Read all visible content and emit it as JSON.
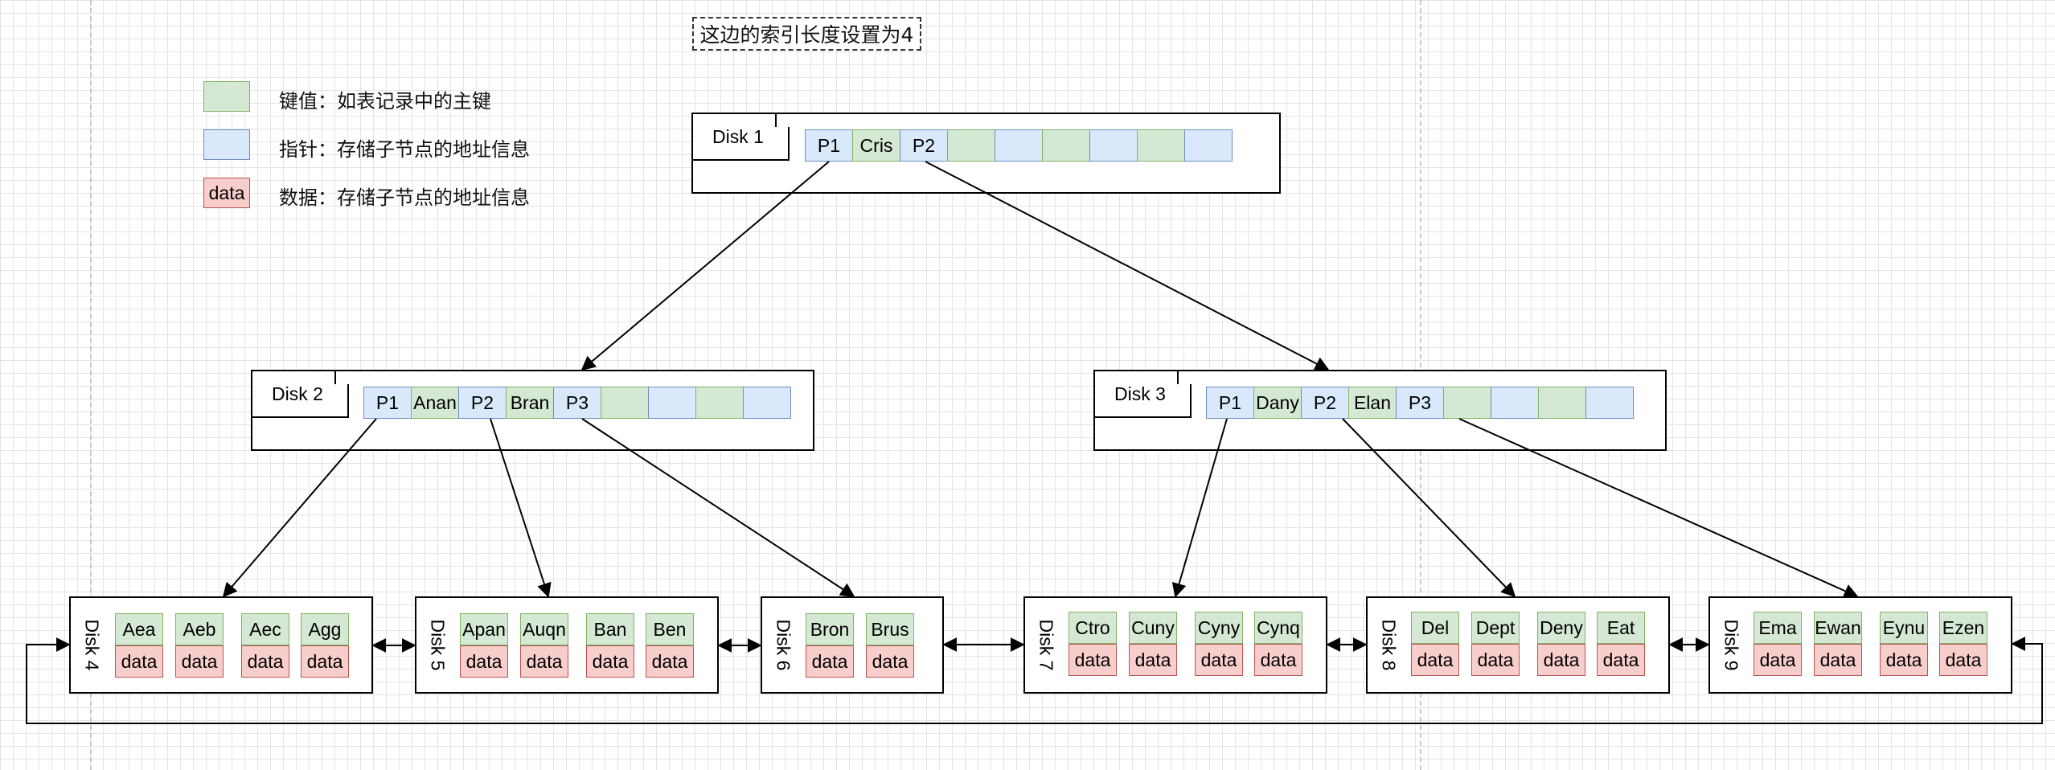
{
  "note": "这边的索引长度设置为4",
  "legend": {
    "key_text": "键值：如表记录中的主键",
    "ptr_text": "指针：存储子节点的地址信息",
    "data_swatch": "data",
    "data_text": "数据：存储子节点的地址信息"
  },
  "colors": {
    "key_fill": "#d5e8d4",
    "key_stroke": "#82b366",
    "ptr_fill": "#dae8fc",
    "ptr_stroke": "#6c8ebf",
    "data_fill": "#f8cecc",
    "data_stroke": "#b85450"
  },
  "root": {
    "label": "Disk 1",
    "cells": [
      "P1",
      "Cris",
      "P2",
      "",
      "",
      "",
      "",
      "",
      "",
      ""
    ]
  },
  "inner": [
    {
      "label": "Disk 2",
      "cells": [
        "P1",
        "Anan",
        "P2",
        "Bran",
        "P3",
        "",
        "",
        "",
        ""
      ]
    },
    {
      "label": "Disk 3",
      "cells": [
        "P1",
        "Dany",
        "P2",
        "Elan",
        "P3",
        "",
        "",
        "",
        ""
      ]
    }
  ],
  "leaves": [
    {
      "label": "Disk 4",
      "keys": [
        "Aea",
        "Aeb",
        "Aec",
        "Agg"
      ],
      "data": [
        "data",
        "data",
        "data",
        "data"
      ]
    },
    {
      "label": "Disk 5",
      "keys": [
        "Apan",
        "Auqn",
        "Ban",
        "Ben"
      ],
      "data": [
        "data",
        "data",
        "data",
        "data"
      ]
    },
    {
      "label": "Disk 6",
      "keys": [
        "Bron",
        "Brus"
      ],
      "data": [
        "data",
        "data"
      ]
    },
    {
      "label": "Disk 7",
      "keys": [
        "Ctro",
        "Cuny",
        "Cyny",
        "Cynq"
      ],
      "data": [
        "data",
        "data",
        "data",
        "data"
      ]
    },
    {
      "label": "Disk 8",
      "keys": [
        "Del",
        "Dept",
        "Deny",
        "Eat"
      ],
      "data": [
        "data",
        "data",
        "data",
        "data"
      ]
    },
    {
      "label": "Disk 9",
      "keys": [
        "Ema",
        "Ewan",
        "Eynu",
        "Ezen"
      ],
      "data": [
        "data",
        "data",
        "data",
        "data"
      ]
    }
  ]
}
